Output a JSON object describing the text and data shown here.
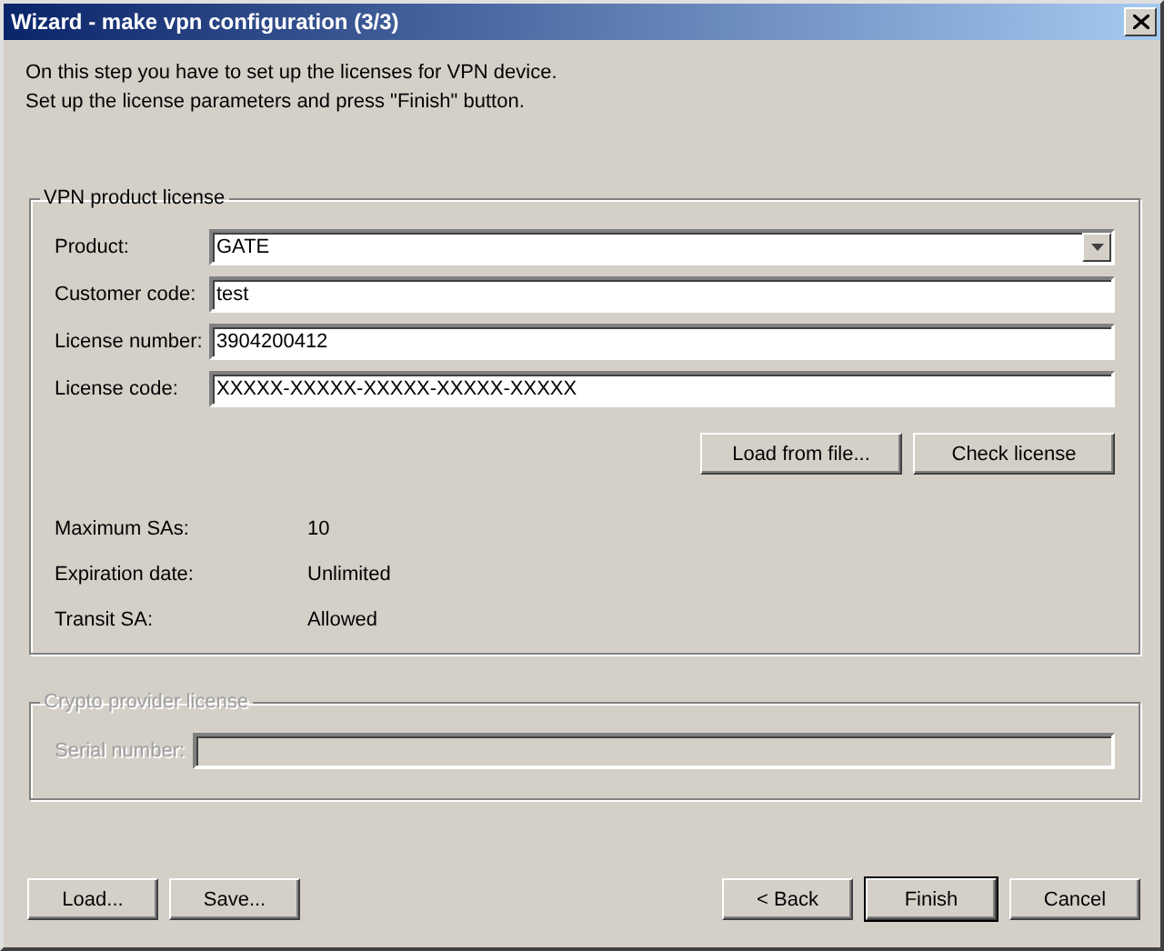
{
  "window": {
    "title": "Wizard - make vpn configuration (3/3)"
  },
  "intro": [
    "On this step you have to set up the licenses for VPN device.",
    "Set up the license parameters and press \"Finish\" button."
  ],
  "product_group": {
    "title": "VPN product license",
    "disabled": false,
    "fields": [
      {
        "label": "Product:",
        "value": "GATE",
        "kind": "dropdown"
      },
      {
        "label": "Customer code:",
        "value": "test",
        "kind": "text"
      },
      {
        "label": "License number:",
        "value": "3904200412",
        "kind": "text"
      },
      {
        "label": "License code:",
        "value": "XXXXX-XXXXX-XXXXX-XXXXX-XXXXX",
        "kind": "text"
      }
    ],
    "buttons": [
      "Load from file...",
      "Check license"
    ],
    "info": [
      {
        "label": "Maximum SAs:",
        "value": "10"
      },
      {
        "label": "Expiration date:",
        "value": "Unlimited"
      },
      {
        "label": "Transit SA:",
        "value": "Allowed"
      }
    ]
  },
  "crypto_group": {
    "title": "Crypto provider license",
    "disabled": true,
    "fields": [
      {
        "label": "Serial number:",
        "kind": "text"
      }
    ]
  },
  "footer": {
    "left": [
      {
        "label": "Load...",
        "default": false
      },
      {
        "label": "Save...",
        "default": false
      }
    ],
    "right": [
      {
        "label": "< Back",
        "default": false
      },
      {
        "label": "Finish",
        "default": true
      },
      {
        "label": "Cancel",
        "default": false
      }
    ]
  }
}
